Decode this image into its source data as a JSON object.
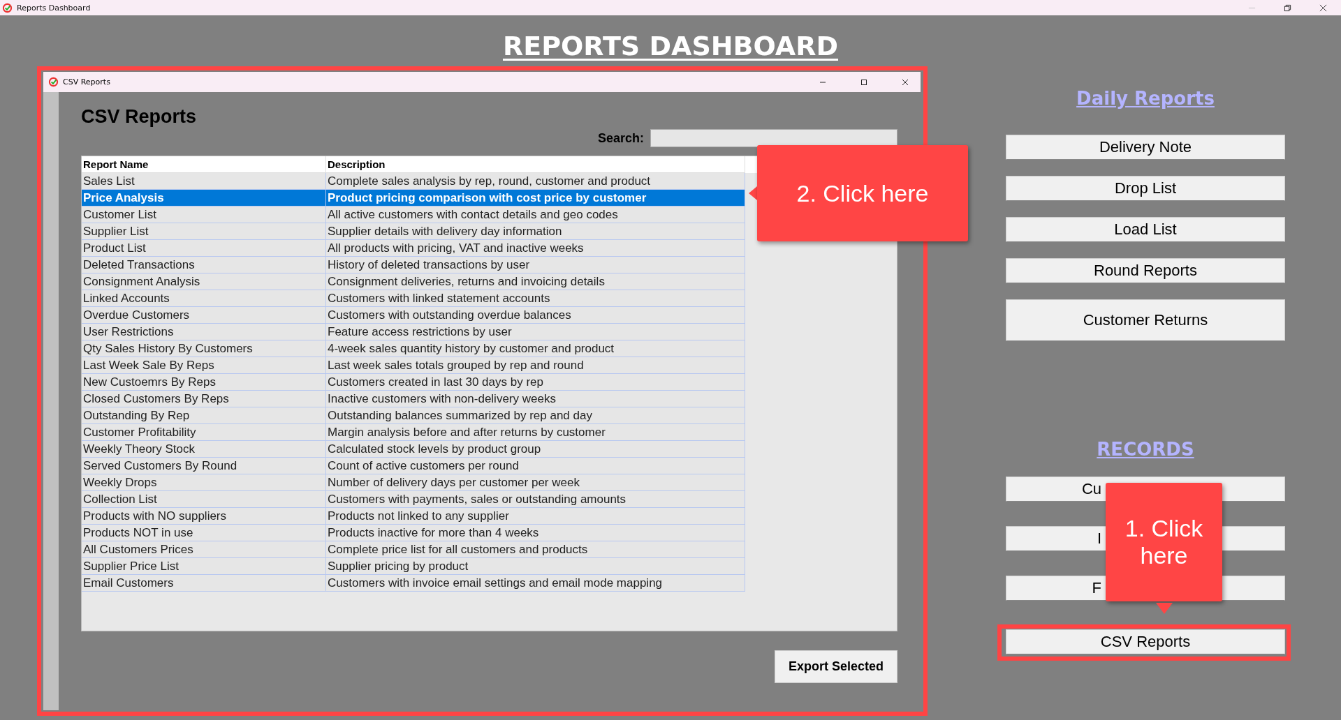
{
  "window": {
    "title": "Reports Dashboard"
  },
  "heading": "REPORTS DASHBOARD",
  "csv_window": {
    "title": "CSV Reports",
    "highlighted": true,
    "heading": "CSV Reports",
    "search": {
      "label": "Search:"
    },
    "table": {
      "columns": [
        "Report Name",
        "Description"
      ],
      "rows": [
        {
          "name": "Sales List",
          "description": "Complete sales analysis by rep, round, customer and product",
          "selected": false
        },
        {
          "name": "Price Analysis",
          "description": "Product pricing comparison with cost price by customer",
          "selected": true
        },
        {
          "name": "Customer List",
          "description": "All active customers with contact details and geo codes",
          "selected": false
        },
        {
          "name": "Supplier List",
          "description": "Supplier details with delivery day information",
          "selected": false
        },
        {
          "name": "Product List",
          "description": "All products with pricing, VAT and inactive weeks",
          "selected": false
        },
        {
          "name": "Deleted Transactions",
          "description": "History of deleted transactions by user",
          "selected": false
        },
        {
          "name": "Consignment Analysis",
          "description": "Consignment deliveries, returns and invoicing details",
          "selected": false
        },
        {
          "name": "Linked Accounts",
          "description": "Customers with linked statement accounts",
          "selected": false
        },
        {
          "name": "Overdue Customers",
          "description": "Customers with outstanding overdue balances",
          "selected": false
        },
        {
          "name": "User Restrictions",
          "description": "Feature access restrictions by user",
          "selected": false
        },
        {
          "name": "Qty Sales History By Customers",
          "description": "4-week sales quantity history by customer and product",
          "selected": false
        },
        {
          "name": "Last Week Sale By Reps",
          "description": "Last week sales totals grouped by rep and round",
          "selected": false
        },
        {
          "name": "New Custoemrs By Reps",
          "description": "Customers created in last 30 days by rep",
          "selected": false
        },
        {
          "name": "Closed Customers By Reps",
          "description": "Inactive customers with non-delivery weeks",
          "selected": false
        },
        {
          "name": "Outstanding By Rep",
          "description": "Outstanding balances summarized by rep and day",
          "selected": false
        },
        {
          "name": "Customer Profitability",
          "description": "Margin analysis before and after returns by customer",
          "selected": false
        },
        {
          "name": "Weekly Theory Stock",
          "description": "Calculated stock levels by product group",
          "selected": false
        },
        {
          "name": "Served Customers By Round",
          "description": "Count of active customers per round",
          "selected": false
        },
        {
          "name": "Weekly Drops",
          "description": "Number of delivery days per customer per week",
          "selected": false
        },
        {
          "name": "Collection List",
          "description": "Customers with payments, sales or outstanding amounts",
          "selected": false
        },
        {
          "name": "Products with NO suppliers",
          "description": "Products not linked to any supplier",
          "selected": false
        },
        {
          "name": "Products NOT in use",
          "description": "Products inactive for more than 4 weeks",
          "selected": false
        },
        {
          "name": "All Customers Prices",
          "description": "Complete price list for all customers and products",
          "selected": false
        },
        {
          "name": "Supplier Price List",
          "description": "Supplier pricing by product",
          "selected": false
        },
        {
          "name": "Email Customers",
          "description": "Customers with invoice email settings and email mode mapping",
          "selected": false
        }
      ]
    },
    "export_button": "Export Selected"
  },
  "daily_reports": {
    "title": "Daily Reports",
    "buttons": [
      {
        "label": "Delivery Note",
        "kind": "normal"
      },
      {
        "label": "Drop List",
        "kind": "normal"
      },
      {
        "label": "Load List",
        "kind": "normal"
      },
      {
        "label": "Round Reports",
        "kind": "normal"
      },
      {
        "label": "Customer Returns",
        "kind": "tall"
      }
    ]
  },
  "records": {
    "title": "RECORDS",
    "buttons": [
      {
        "label": "Cu",
        "kind": "covered",
        "highlighted": false
      },
      {
        "label": "I",
        "kind": "covered",
        "highlighted": false
      },
      {
        "label": "F",
        "kind": "covered",
        "highlighted": false
      },
      {
        "label": "CSV Reports",
        "kind": "normal",
        "highlighted": true
      }
    ]
  },
  "callouts": [
    {
      "text": "2. Click here"
    },
    {
      "text": "1. Click here"
    }
  ]
}
